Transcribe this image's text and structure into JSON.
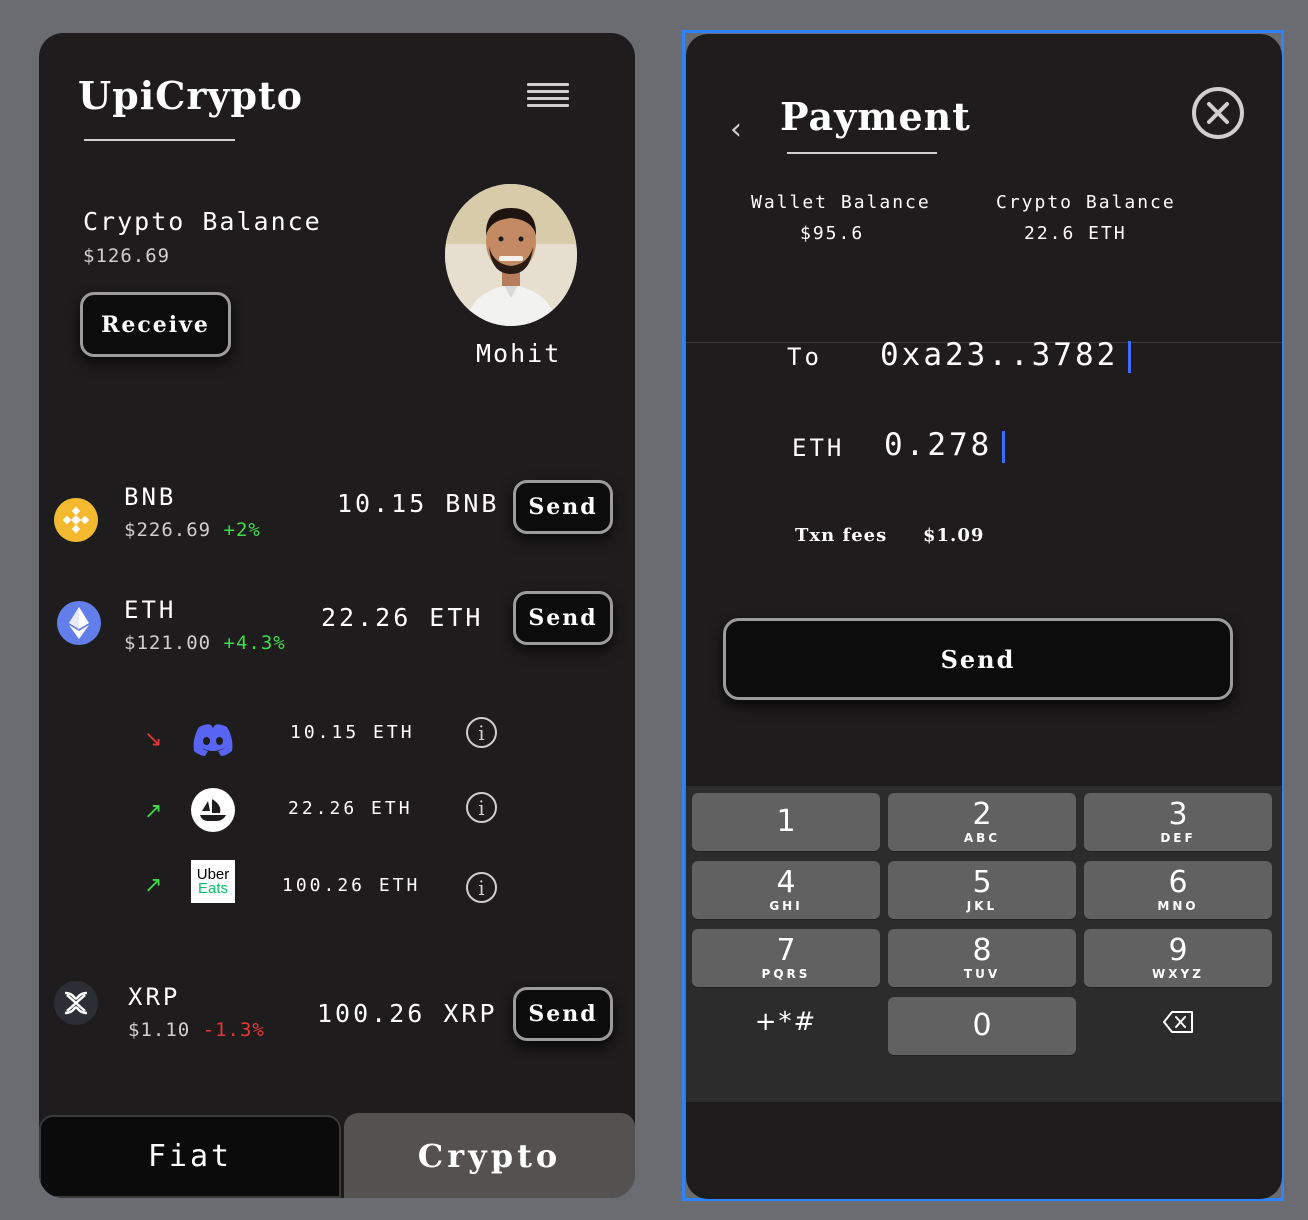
{
  "left_app": {
    "title": "UpiCrypto",
    "balance_label": "Crypto Balance",
    "balance_value": "$126.69",
    "receive_label": "Receive",
    "user_name": "Mohit",
    "coins": [
      {
        "name": "BNB",
        "price": "$226.69",
        "change": "+2%",
        "amount": "10.15 BNB",
        "send_label": "Send",
        "icon": "bnb-icon",
        "color": "#f3ba2f"
      },
      {
        "name": "ETH",
        "price": "$121.00",
        "change": "+4.3%",
        "amount": "22.26 ETH",
        "send_label": "Send",
        "icon": "eth-icon",
        "color": "#627eea"
      },
      {
        "name": "XRP",
        "price": "$1.10",
        "change": "-1.3%",
        "amount": "100.26 XRP",
        "send_label": "Send",
        "icon": "xrp-icon",
        "color": "#23292f"
      }
    ],
    "transactions": [
      {
        "direction": "↘",
        "direction_color": "#e53935",
        "merchant_icon": "discord-icon",
        "amount": "10.15 ETH"
      },
      {
        "direction": "↗",
        "direction_color": "#3ddc4a",
        "merchant_icon": "opensea-icon",
        "amount": "22.26 ETH"
      },
      {
        "direction": "↗",
        "direction_color": "#3ddc4a",
        "merchant_icon": "uber-eats-icon",
        "merchant_text": [
          "Uber",
          "Eats"
        ],
        "amount": "100.26 ETH"
      }
    ],
    "tabs": {
      "fiat": "Fiat",
      "crypto": "Crypto"
    }
  },
  "payment": {
    "title": "Payment",
    "wallet_balance_label": "Wallet Balance",
    "wallet_balance_value": "$95.6",
    "crypto_balance_label": "Crypto Balance",
    "crypto_balance_value": "22.6 ETH",
    "to_label": "To",
    "to_value": "0xa23..3782",
    "amount_label": "ETH",
    "amount_value": "0.278",
    "fees_label": "Txn fees",
    "fees_value": "$1.09",
    "send_label": "Send"
  },
  "keypad": {
    "keys": [
      {
        "num": "1",
        "letters": ""
      },
      {
        "num": "2",
        "letters": "ABC"
      },
      {
        "num": "3",
        "letters": "DEF"
      },
      {
        "num": "4",
        "letters": "GHI"
      },
      {
        "num": "5",
        "letters": "JKL"
      },
      {
        "num": "6",
        "letters": "MNO"
      },
      {
        "num": "7",
        "letters": "PQRS"
      },
      {
        "num": "8",
        "letters": "TUV"
      },
      {
        "num": "9",
        "letters": "WXYZ"
      }
    ],
    "symbols": "+*#",
    "zero": "0"
  },
  "colors": {
    "accent_caret": "#3b6cff",
    "selection": "#2f83ff",
    "positive": "#3ddc4a",
    "negative": "#e53935"
  }
}
